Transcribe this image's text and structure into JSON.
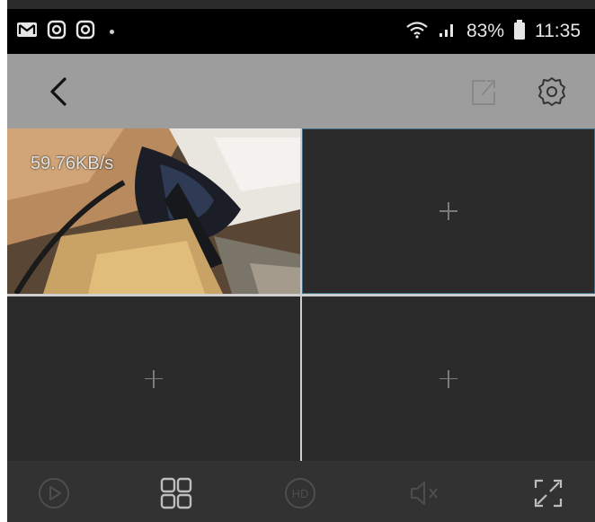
{
  "status_bar": {
    "icons_left": [
      "gmail-icon",
      "instagram-icon",
      "instagram-icon"
    ],
    "battery_percent": "83%",
    "time": "11:35",
    "icons_right": [
      "wifi-icon",
      "signal-icon",
      "battery-icon"
    ]
  },
  "toolbar": {
    "icons": [
      "back-icon",
      "share-icon",
      "settings-icon"
    ]
  },
  "camera_grid": {
    "active_cell": {
      "speed": "59.76KB/s"
    },
    "empty_cells": 3
  },
  "bottom_bar": {
    "icons": [
      "play-icon",
      "grid-layout-icon",
      "hd-icon",
      "mute-icon",
      "fullscreen-icon"
    ]
  },
  "colors": {
    "status_bg": "#000000",
    "toolbar_bg": "#9d9d9d",
    "cell_bg": "#2b2b2b",
    "grid_divider": "#cfcfcf",
    "selected_border": "#3d6f86"
  }
}
